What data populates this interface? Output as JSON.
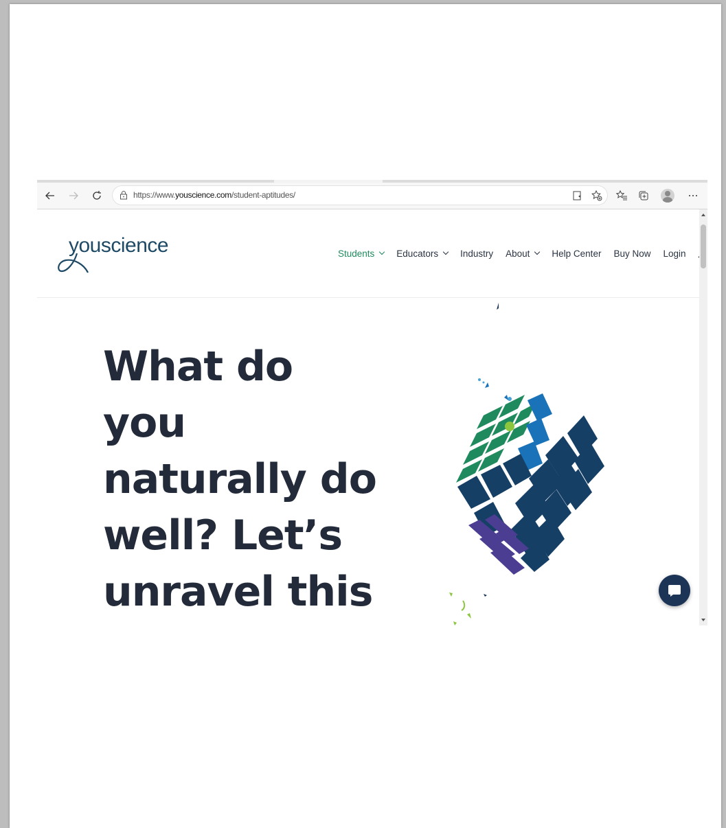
{
  "browser": {
    "url_prefix": "https://www.",
    "url_domain": "youscience.com",
    "url_path": "/student-aptitudes/",
    "toolbar_icons": [
      "back-icon",
      "forward-icon",
      "refresh-icon",
      "lock-icon",
      "read-aloud-icon",
      "add-favorite-icon",
      "favorites-icon",
      "collections-icon",
      "profile-icon",
      "more-icon"
    ]
  },
  "site": {
    "logo_text": "youscience",
    "nav": [
      {
        "label": "Students",
        "has_dropdown": true,
        "active": true
      },
      {
        "label": "Educators",
        "has_dropdown": true,
        "active": false
      },
      {
        "label": "Industry",
        "has_dropdown": false,
        "active": false
      },
      {
        "label": "About",
        "has_dropdown": true,
        "active": false
      },
      {
        "label": "Help Center",
        "has_dropdown": false,
        "active": false
      },
      {
        "label": "Buy Now",
        "has_dropdown": false,
        "active": false
      },
      {
        "label": "Login",
        "has_dropdown": false,
        "active": false
      }
    ]
  },
  "hero": {
    "title": "What do you naturally do well? Let’s unravel this riddle."
  },
  "colors": {
    "brand_navy": "#1f4a66",
    "nav_active": "#1e8a5e",
    "title": "#232b3a",
    "cube_green": "#1e8a5e",
    "cube_blue": "#1a73b8",
    "cube_navy": "#163f66",
    "cube_purple": "#4b3d92",
    "chat_button": "#1c3557"
  }
}
